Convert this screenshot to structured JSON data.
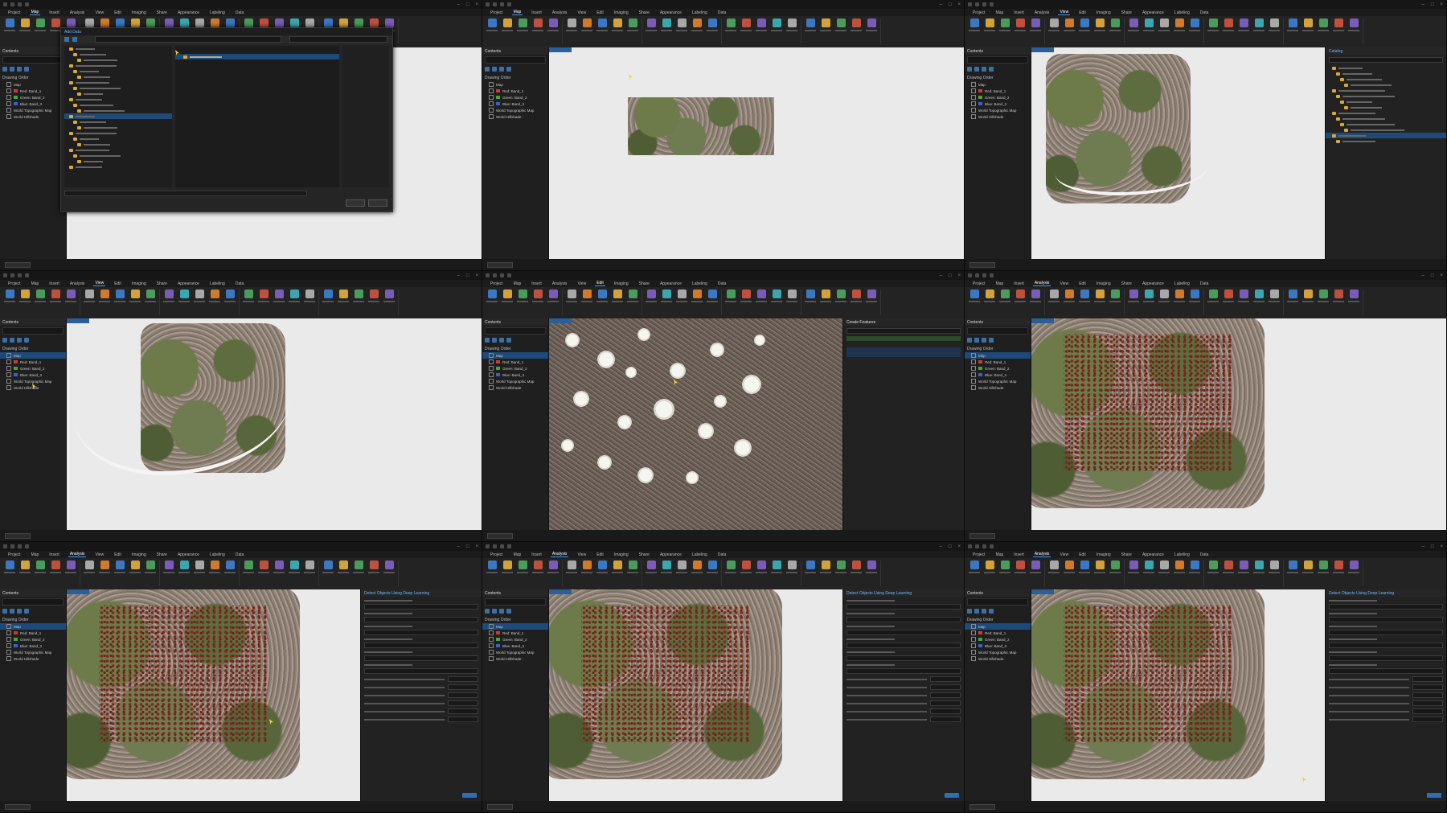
{
  "ribbon_tabs": [
    "Project",
    "Map",
    "Insert",
    "Analysis",
    "View",
    "Edit",
    "Imaging",
    "Share",
    "Appearance",
    "Labeling",
    "Data"
  ],
  "tiles": [
    {
      "id": "t1",
      "active_tab": "Map",
      "pane": "dialog",
      "dialog_title": "Add Data"
    },
    {
      "id": "t2",
      "active_tab": "Map",
      "pane": "none"
    },
    {
      "id": "t3",
      "active_tab": "View",
      "pane": "catalog",
      "side_title": "Catalog"
    },
    {
      "id": "t4",
      "active_tab": "View",
      "pane": "none"
    },
    {
      "id": "t5",
      "active_tab": "Edit",
      "pane": "create-features",
      "side_title": "Create Features"
    },
    {
      "id": "t6",
      "active_tab": "Analysis",
      "pane": "none"
    },
    {
      "id": "t7",
      "active_tab": "Analysis",
      "pane": "gp",
      "side_title": "Detect Objects Using Deep Learning"
    },
    {
      "id": "t8",
      "active_tab": "Analysis",
      "pane": "gp",
      "side_title": "Detect Objects Using Deep Learning"
    },
    {
      "id": "t9",
      "active_tab": "Analysis",
      "pane": "gp",
      "side_title": "Detect Objects Using Deep Learning"
    }
  ],
  "contents": {
    "title": "Contents",
    "drawing_order": "Drawing Order",
    "map": "Map",
    "layers": [
      "Red: Band_1",
      "Green: Band_2",
      "Blue: Band_3",
      "World Topographic Map",
      "World Hillshade"
    ]
  },
  "colors": {
    "accent": "#3fa0ff",
    "selection": "#1d4a78",
    "band_red": "#d33a2e",
    "band_green": "#4aa33b",
    "band_blue": "#3a5fcf",
    "detections": "#7a2a1c"
  }
}
